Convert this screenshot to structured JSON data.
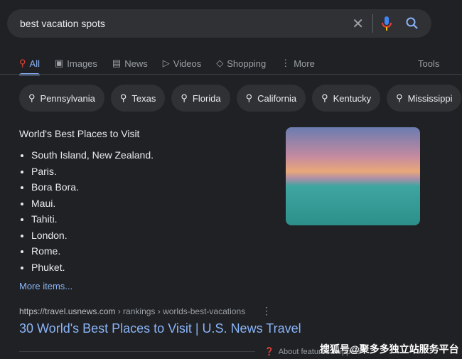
{
  "search": {
    "query": "best vacation spots"
  },
  "tabs": [
    {
      "label": "All",
      "icon": "search-icon"
    },
    {
      "label": "Images",
      "icon": "image-icon"
    },
    {
      "label": "News",
      "icon": "news-icon"
    },
    {
      "label": "Videos",
      "icon": "play-icon"
    },
    {
      "label": "Shopping",
      "icon": "tag-icon"
    },
    {
      "label": "More",
      "icon": "kebab-icon"
    }
  ],
  "tools_label": "Tools",
  "chips": [
    "Pennsylvania",
    "Texas",
    "Florida",
    "California",
    "Kentucky",
    "Mississippi"
  ],
  "snippet": {
    "title": "World's Best Places to Visit",
    "items": [
      "South Island, New Zealand.",
      "Paris.",
      "Bora Bora.",
      "Maui.",
      "Tahiti.",
      "London.",
      "Rome.",
      "Phuket."
    ],
    "more": "More items..."
  },
  "result": {
    "url": "https://travel.usnews.com",
    "crumbs": " › rankings › worlds-best-vacations",
    "title": "30 World's Best Places to Visit | U.S. News Travel"
  },
  "about": "About featured snippets",
  "watermark": "搜狐号@聚多多独立站服务平台"
}
